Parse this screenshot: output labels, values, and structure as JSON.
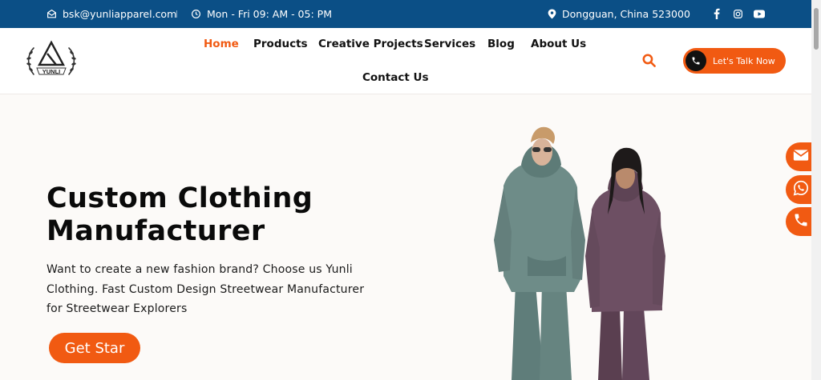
{
  "topbar": {
    "email": "bsk@yunliapparel.com",
    "hours": "Mon - Fri 09: AM - 05: PM",
    "location": "Dongguan, China 523000",
    "social": [
      "facebook-icon",
      "instagram-icon",
      "youtube-icon"
    ]
  },
  "logo": {
    "text": "YUNLI"
  },
  "nav": {
    "items": [
      "Home",
      "Products",
      "Creative Projects",
      "Services",
      "Blog",
      "About Us",
      "Contact Us"
    ],
    "active": "Home"
  },
  "header": {
    "talk_label": "Let's Talk Now"
  },
  "hero": {
    "title_line1": "Custom Clothing",
    "title_line2": "Manufacturer",
    "desc_line1": "Want to create a new fashion brand? Choose us Yunli",
    "desc_line2": "Clothing. Fast Custom Design Streetwear Manufacturer",
    "desc_line3": "for Streetwear Explorers",
    "cta": "Get Star"
  },
  "floating": [
    "mail-icon",
    "whatsapp-icon",
    "phone-icon"
  ],
  "colors": {
    "topbar": "#0b4f86",
    "accent": "#f15a12",
    "background": "#fcfaf8"
  }
}
